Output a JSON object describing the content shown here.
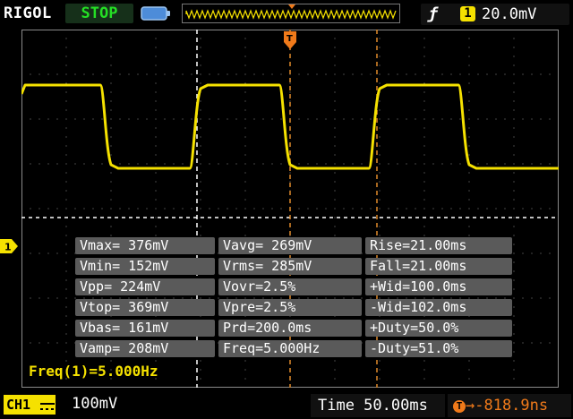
{
  "header": {
    "brand": "RIGOL",
    "run_status": "STOP",
    "trigger": {
      "edge_icon": "rising-edge-icon",
      "source": "1",
      "level": "20.0mV"
    }
  },
  "channel": {
    "marker": "1",
    "label": "CH1",
    "coupling_icon": "dc-coupling-icon",
    "scale": "100mV"
  },
  "waveform": {
    "color": "#f5e100",
    "high_level": "376mV",
    "low_level": "152mV",
    "frequency": "5.000Hz"
  },
  "measurements": [
    [
      "Vmax= 376mV",
      "Vavg= 269mV",
      "Rise=21.00ms"
    ],
    [
      "Vmin= 152mV",
      "Vrms= 285mV",
      "Fall=21.00ms"
    ],
    [
      "Vpp= 224mV",
      "Vovr=2.5%",
      "+Wid=100.0ms"
    ],
    [
      "Vtop= 369mV",
      "Vpre=2.5%",
      "-Wid=102.0ms"
    ],
    [
      "Vbas= 161mV",
      "Prd=200.0ms",
      "+Duty=50.0%"
    ],
    [
      "Vamp= 208mV",
      "Freq=5.000Hz",
      "-Duty=51.0%"
    ]
  ],
  "freq_readout": "Freq(1)=5.000Hz",
  "footer": {
    "timebase": "Time 50.00ms",
    "trigger_icon": "T",
    "trigger_offset": "→-818.9ns"
  },
  "colors": {
    "trace": "#f5e100",
    "trigger": "#f07a1a",
    "status": "#25e025",
    "grid": "#aaaaaa"
  }
}
